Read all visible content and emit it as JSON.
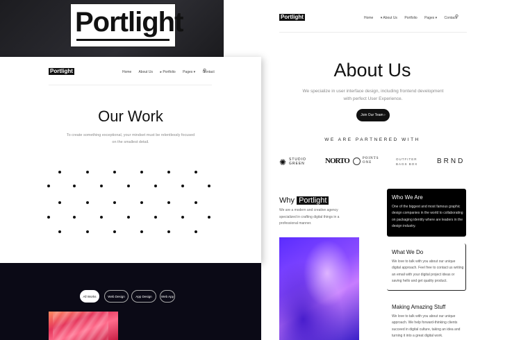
{
  "hero_logo": {
    "text": "Portlight"
  },
  "right_page": {
    "nav_logo": "Portlight",
    "nav_links": [
      "Home",
      "About Us",
      "Portfolio",
      "Pages"
    ],
    "contact": "Contact",
    "title": "About Us",
    "subtitle": "We specialize in user interface design, including frontend development with perfect User Experience.",
    "join_button": "Join Our Team",
    "partnered_heading": "WE ARE PARTNERED WITH",
    "partners": [
      {
        "line1": "STUDIO",
        "line2": "GREEN"
      },
      {
        "name": "NORTO"
      },
      {
        "line1": "POINTS",
        "line2": "ONE"
      },
      {
        "line1": "OUTFITER",
        "line2": "BAGS BOX"
      },
      {
        "name": "BRND"
      }
    ],
    "why": {
      "prefix": "Why",
      "highlight": "Portlight",
      "description": "We are a modern and creative agency specialized in crafting digital things in a professional manner."
    },
    "cards": [
      {
        "title": "Who We Are",
        "text": "One of the biggest and most famous graphic design companies in the world to collaborating on packaging identity where are leaders in the design industry."
      },
      {
        "title": "What We Do",
        "text": "We love to talk with you about our unique digital approach. Feel free to contact us writing an email with your digital project ideas or saving hello and get quality product."
      },
      {
        "title": "Making Amazing Stuff",
        "text": "We love to talk with you about our unique approach. We help forward-thinking clients succeed in digital culture, taking an idea and turning it into a great digital work."
      }
    ]
  },
  "left_page": {
    "nav_logo": "Portlight",
    "nav_links": [
      "Home",
      "About Us",
      "Portfolio",
      "Pages"
    ],
    "contact": "Contact",
    "title": "Our Work",
    "subtitle": "To create something exceptional, your mindset must be relentlessly focused on the smallest detail.",
    "filters": [
      "All Works",
      "Web Design",
      "App Design",
      "Web App"
    ]
  }
}
